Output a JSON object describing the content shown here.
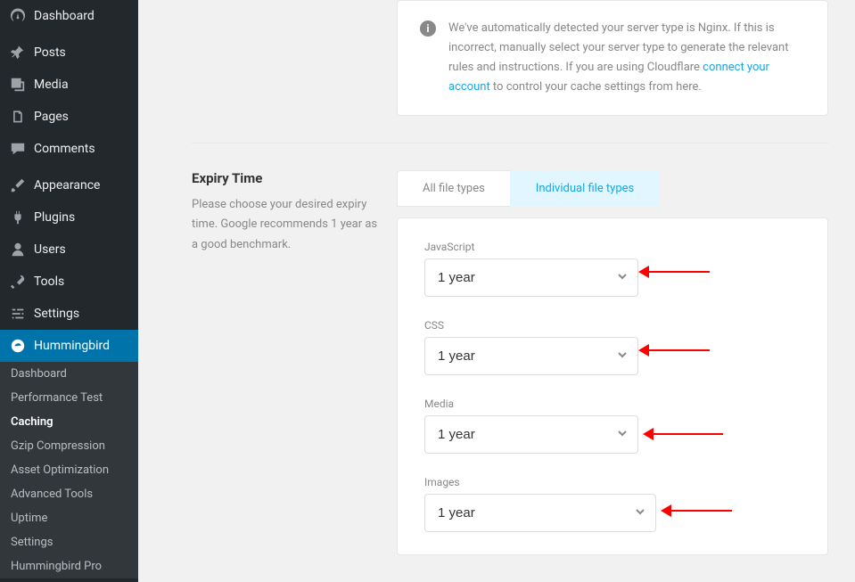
{
  "sidebar": {
    "items": [
      {
        "label": "Dashboard"
      },
      {
        "label": "Posts"
      },
      {
        "label": "Media"
      },
      {
        "label": "Pages"
      },
      {
        "label": "Comments"
      },
      {
        "label": "Appearance"
      },
      {
        "label": "Plugins"
      },
      {
        "label": "Users"
      },
      {
        "label": "Tools"
      },
      {
        "label": "Settings"
      },
      {
        "label": "Hummingbird"
      }
    ],
    "submenu": [
      {
        "label": "Dashboard"
      },
      {
        "label": "Performance Test"
      },
      {
        "label": "Caching"
      },
      {
        "label": "Gzip Compression"
      },
      {
        "label": "Asset Optimization"
      },
      {
        "label": "Advanced Tools"
      },
      {
        "label": "Uptime"
      },
      {
        "label": "Settings"
      },
      {
        "label": "Hummingbird Pro"
      }
    ]
  },
  "notice": {
    "text_prefix": "We've automatically detected your server type is Nginx. If this is incorrect, manually select your server type to generate the relevant rules and instructions. If you are using Cloudflare ",
    "link_text": "connect your account",
    "text_suffix": " to control your cache settings from here."
  },
  "section": {
    "title": "Expiry Time",
    "description": "Please choose your desired expiry time. Google recommends 1 year as a good benchmark."
  },
  "tabs": {
    "all": "All file types",
    "individual": "Individual file types"
  },
  "fields": [
    {
      "label": "JavaScript",
      "value": "1 year"
    },
    {
      "label": "CSS",
      "value": "1 year"
    },
    {
      "label": "Media",
      "value": "1 year"
    },
    {
      "label": "Images",
      "value": "1 year"
    }
  ]
}
